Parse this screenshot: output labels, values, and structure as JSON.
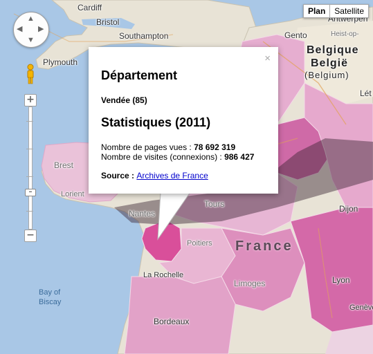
{
  "map_type": {
    "plan": "Plan",
    "satellite": "Satellite",
    "selected": "Plan"
  },
  "labels": {
    "cardiff": "Cardiff",
    "bristol": "Bristol",
    "southampton": "Southampton",
    "plymouth": "Plymouth",
    "gento": "Gento",
    "antwerpen": "Antwerpen",
    "heist": "Heist-op-",
    "belgique": "Belgique",
    "belgie": "België",
    "belgium": "(Belgium)",
    "let": "Lét",
    "brest": "Brest",
    "lorient": "Lorient",
    "nantes": "Nantes",
    "tours": "Tours",
    "poitiers": "Poitiers",
    "la_rochelle": "La Rochelle",
    "limoges": "Limoges",
    "bordeaux": "Bordeaux",
    "dijon": "Dijon",
    "lyon": "Lyon",
    "geneve": "Genève",
    "france": "France",
    "bay_of_biscay_1": "Bay of",
    "bay_of_biscay_2": "Biscay"
  },
  "info_window": {
    "heading": "Département",
    "department": "Vendée (85)",
    "stats_heading": "Statistiques (2011)",
    "pages_label": "Nombre de pages vues : ",
    "pages_value": "78 692 319",
    "visits_label": "Nombre de visites (connexions) : ",
    "visits_value": "986 427",
    "source_label": "Source : ",
    "source_link": "Archives de France",
    "close": "×"
  },
  "colors": {
    "sea": "#a9c7e6",
    "land": "#e8e3d6",
    "highlight": "#d94f9a",
    "light_pink": "#eec6de",
    "mid_pink": "#e294c2",
    "dark_pink": "#c2418a"
  }
}
